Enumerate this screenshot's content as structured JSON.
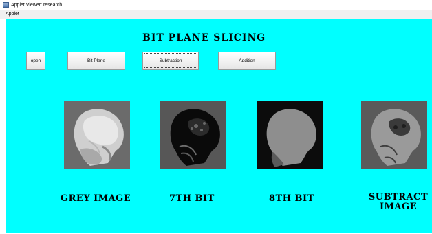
{
  "window": {
    "title": "Applet Viewer: research"
  },
  "menu": {
    "items": [
      "Applet"
    ]
  },
  "heading": "BIT PLANE SLICING",
  "buttons": {
    "open": "open",
    "bitplane": "Bit Plane",
    "subtraction": "Subtraction",
    "addition": "Addition"
  },
  "images": [
    {
      "label": "GREY IMAGE",
      "icon": "grey-xray-image"
    },
    {
      "label": "7TH BIT",
      "icon": "bit7-xray-image"
    },
    {
      "label": "8TH BIT",
      "icon": "bit8-xray-image"
    },
    {
      "label_line1": "SUBTRACT",
      "label_line2": "IMAGE",
      "icon": "subtract-xray-image"
    }
  ],
  "colors": {
    "canvas": "#00ffff",
    "titlebar": "#ffffff",
    "menubar": "#f0f0f0"
  }
}
